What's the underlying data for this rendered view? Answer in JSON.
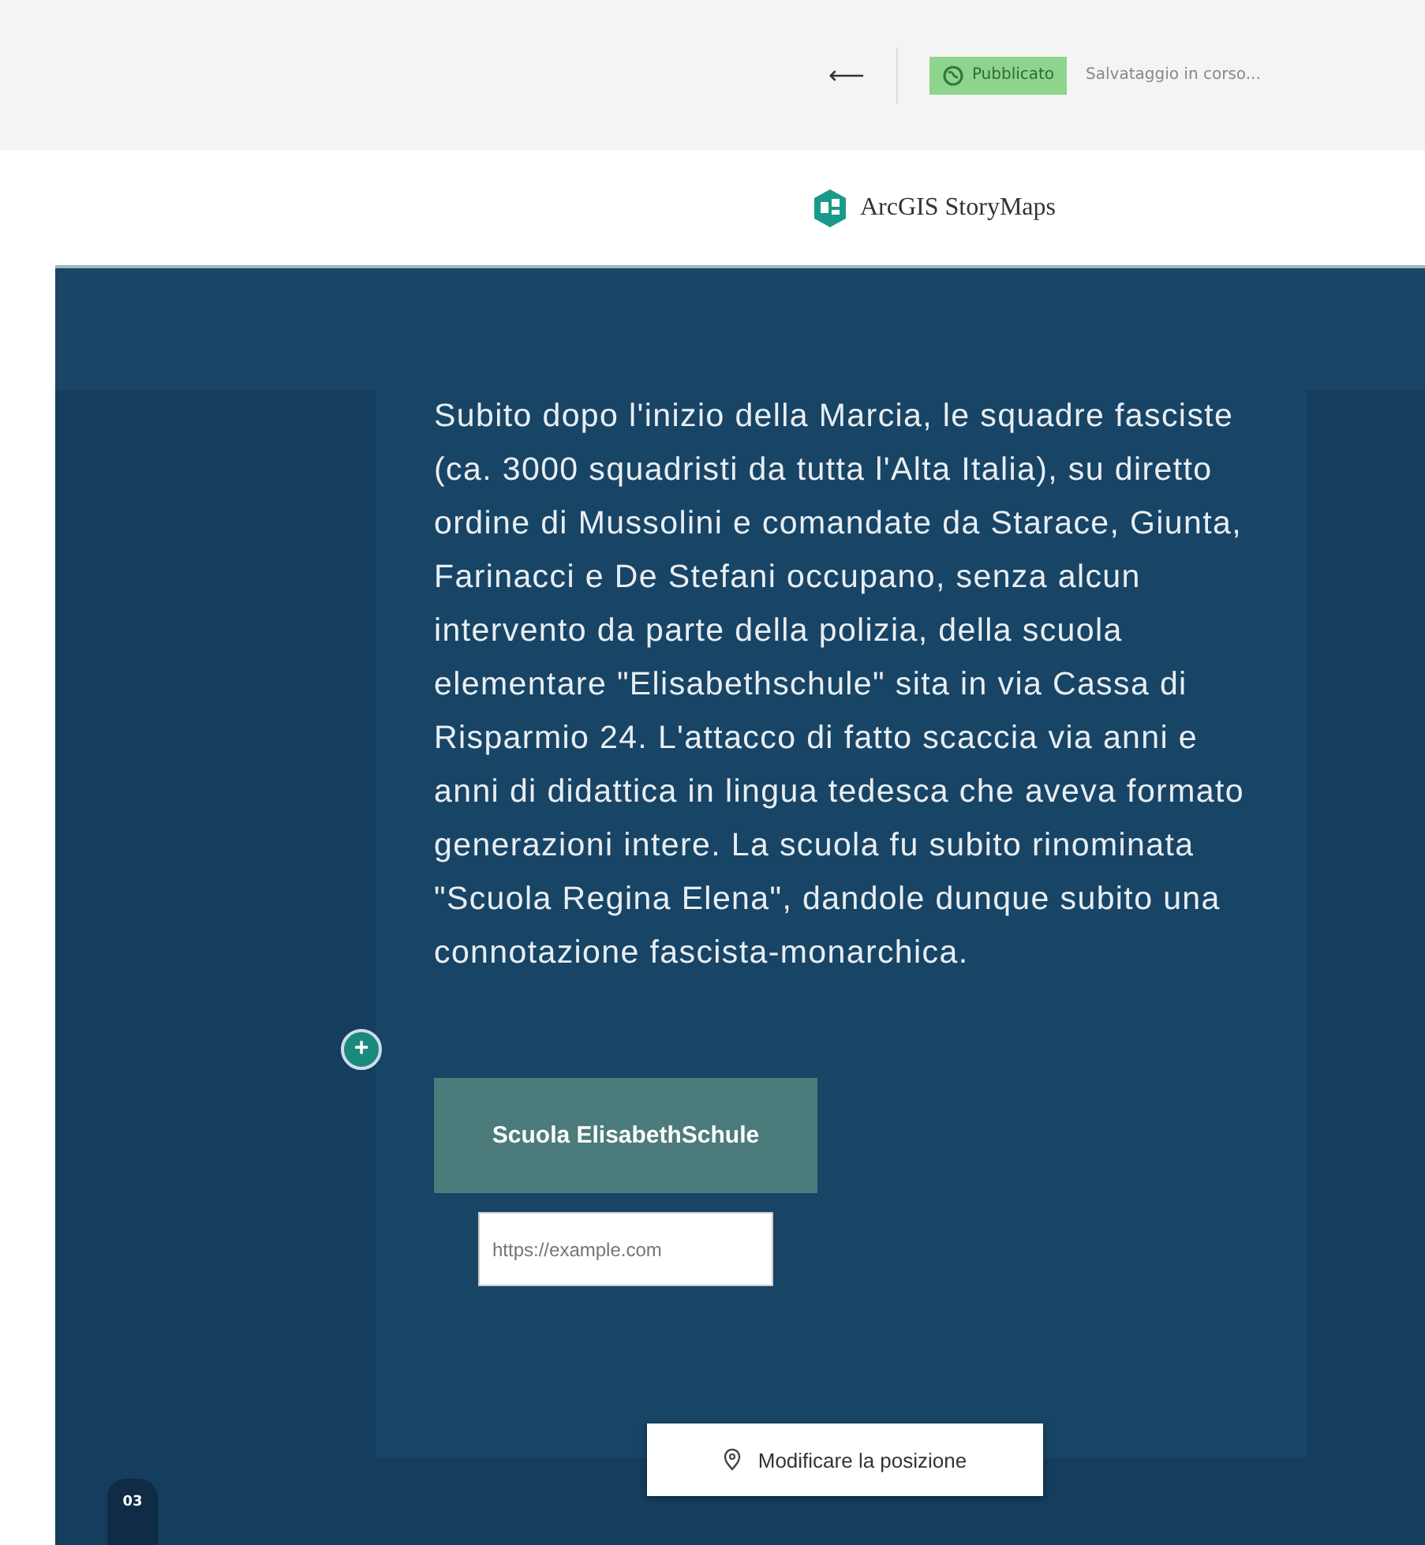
{
  "toolbar": {
    "back": "⟵",
    "status": {
      "label": "Pubblicato",
      "published": true
    },
    "save_state": "Salvataggio in corso..."
  },
  "header": {
    "brand": "ArcGIS StoryMaps"
  },
  "card": {
    "paragraph": "Subito dopo l'inizio della Marcia, le squadre fasciste (ca. 3000 squadristi da tutta l'Alta Italia), su diretto ordine di Mussolini e comandate da Starace, Giunta, Farinacci e De Stefani occupano, senza alcun intervento da parte della polizia, della scuola elementare \"Elisabethschule\" sita in via Cassa di Risparmio 24. L'attacco di fatto scaccia via anni e anni di didattica in lingua tedesca che aveva formato generazioni intere. La scuola fu subito rinominata \"Scuola Regina Elena\", dandole dunque subito una connotazione fascista-monarchica.",
    "add_button": "+",
    "button_label": "Scuola ElisabethSchule",
    "url_field": {
      "placeholder": "https://example.com"
    },
    "location_button": "Modificare la posizione"
  },
  "slide_number": "03"
}
